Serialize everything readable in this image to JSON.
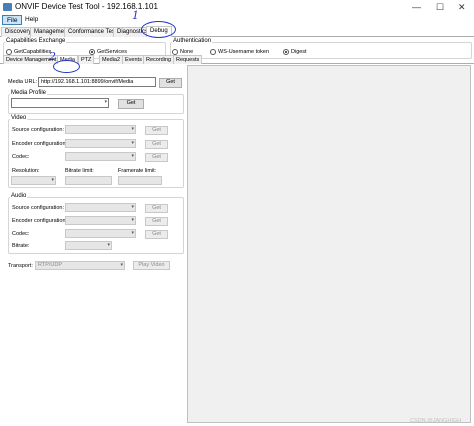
{
  "window": {
    "title": "ONVIF Device Test Tool - 192.168.1.101",
    "controls": {
      "minimize": "—",
      "maximize": "☐",
      "close": "✕"
    }
  },
  "menu": [
    {
      "label": "File",
      "active": true
    },
    {
      "label": "Help",
      "active": false
    }
  ],
  "main_tabs": [
    "Discovery",
    "Management",
    "Conformance Test",
    "Diagnostics",
    "Debug"
  ],
  "capabilities": {
    "legend": "Capabilities Exchange",
    "options": [
      "GetCapabilities",
      "GetServices"
    ],
    "selected": "GetServices"
  },
  "authentication": {
    "legend": "Authentication",
    "options": [
      "None",
      "WS-Username token",
      "Digest"
    ],
    "selected": "Digest"
  },
  "sub_tabs": [
    "Device Management",
    "Media",
    "PTZ",
    "Media2",
    "Events",
    "Recording",
    "Requests"
  ],
  "media_url": {
    "label": "Media URL:",
    "value": "http://192.168.1.101:8899/onvif/Media",
    "button": "Get"
  },
  "media_profile": {
    "legend": "Media Profile",
    "button": "Get"
  },
  "video": {
    "legend": "Video",
    "rows": [
      {
        "label": "Source configuration:",
        "button": "Get"
      },
      {
        "label": "Encoder configuration:",
        "button": "Get"
      },
      {
        "label": "Codec:",
        "button": "Get"
      }
    ],
    "resolution_label": "Resolution:",
    "bitrate_limit_label": "Bitrate limit:",
    "framerate_limit_label": "Framerate limit:"
  },
  "audio": {
    "legend": "Audio",
    "rows": [
      {
        "label": "Source configuration:",
        "button": "Get"
      },
      {
        "label": "Encoder configuration:",
        "button": "Get"
      },
      {
        "label": "Codec:",
        "button": "Get"
      }
    ],
    "bitrate_label": "Bitrate:"
  },
  "transport": {
    "label": "Transport:",
    "value": "RTP/UDP",
    "button": "Play Video"
  },
  "annotations": {
    "one": "1",
    "two": "2"
  },
  "watermark": "CSDN @JANGHIGH",
  "colors": {
    "annotation": "#2438c8",
    "selected_menu": "#cce4f7",
    "video_area": "#f0f0f0"
  }
}
